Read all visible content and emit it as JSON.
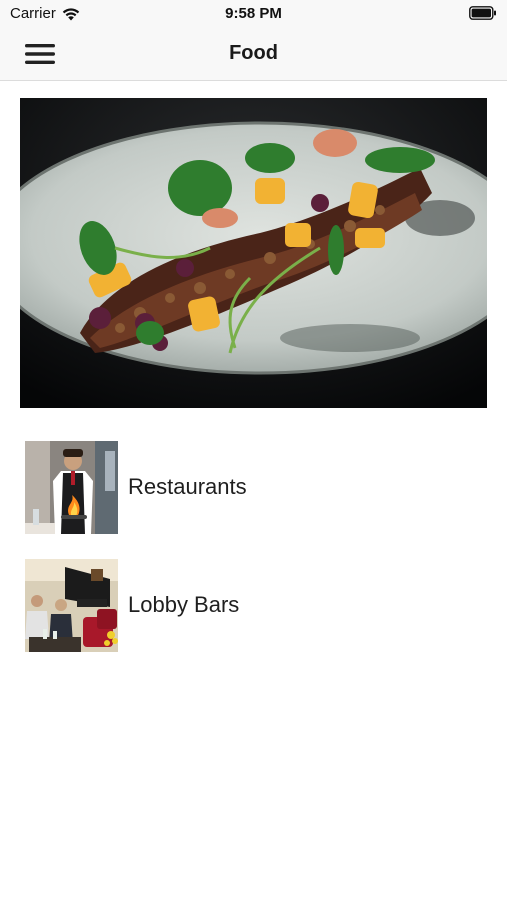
{
  "status_bar": {
    "carrier": "Carrier",
    "time": "9:58 PM",
    "wifi_icon": "wifi-icon",
    "battery_icon": "battery-icon"
  },
  "nav": {
    "title": "Food",
    "menu_icon": "hamburger-menu-icon"
  },
  "hero": {
    "image": "plated-dish-photo"
  },
  "items": [
    {
      "label": "Restaurants",
      "thumbnail": "waiter-flambe-photo"
    },
    {
      "label": "Lobby Bars",
      "thumbnail": "lobby-bar-photo"
    }
  ],
  "colors": {
    "bar_background": "#f8f8f8",
    "divider": "#dcdcdc",
    "text": "#1f1f1f"
  }
}
